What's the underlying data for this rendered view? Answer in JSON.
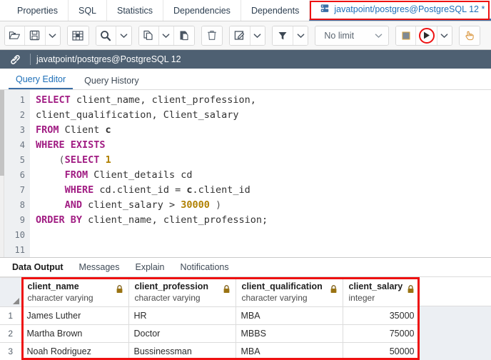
{
  "object_tabs": {
    "items": [
      {
        "label": "Properties",
        "active": false,
        "icon": ""
      },
      {
        "label": "SQL",
        "active": false,
        "icon": ""
      },
      {
        "label": "Statistics",
        "active": false,
        "icon": ""
      },
      {
        "label": "Dependencies",
        "active": false,
        "icon": ""
      },
      {
        "label": "Dependents",
        "active": false,
        "icon": ""
      },
      {
        "label": "javatpoint/postgres@PostgreSQL 12 *",
        "active": true,
        "icon": "database-server-icon"
      }
    ]
  },
  "toolbar": {
    "groups": [
      {
        "buttons": [
          {
            "name": "open-file-button",
            "icon": "open-folder-icon",
            "label": "Open File"
          },
          {
            "name": "save-file-button",
            "icon": "floppy-save-icon",
            "label": "Save"
          },
          {
            "name": "save-dropdown",
            "icon": "chevron-down-icon",
            "label": "Save options"
          }
        ]
      },
      {
        "buttons": [
          {
            "name": "edit-grid-button",
            "icon": "grid-edit-icon",
            "label": "Edit grid"
          }
        ]
      },
      {
        "buttons": [
          {
            "name": "find-button",
            "icon": "magnifier-icon",
            "label": "Find"
          },
          {
            "name": "find-dropdown",
            "icon": "chevron-down-icon",
            "label": "Find options"
          }
        ]
      },
      {
        "buttons": [
          {
            "name": "copy-button",
            "icon": "copy-icon",
            "label": "Copy"
          },
          {
            "name": "copy-dropdown",
            "icon": "chevron-down-icon",
            "label": "Copy options"
          },
          {
            "name": "paste-button",
            "icon": "paste-icon",
            "label": "Paste"
          }
        ]
      },
      {
        "buttons": [
          {
            "name": "delete-button",
            "icon": "trash-icon",
            "label": "Delete"
          }
        ]
      },
      {
        "buttons": [
          {
            "name": "edit-button",
            "icon": "pencil-square-icon",
            "label": "Edit"
          },
          {
            "name": "edit-dropdown",
            "icon": "chevron-down-icon",
            "label": "Edit options"
          }
        ]
      },
      {
        "buttons": [
          {
            "name": "filter-button",
            "icon": "funnel-filter-icon",
            "label": "Filter"
          },
          {
            "name": "filter-dropdown",
            "icon": "chevron-down-icon",
            "label": "Filter options"
          }
        ]
      }
    ],
    "row_limit": {
      "value": "No limit",
      "icon": "chevron-down-icon"
    },
    "exec_group": [
      {
        "name": "stop-button",
        "icon": "stop-square-icon",
        "label": "Stop"
      },
      {
        "name": "execute-button",
        "icon": "play-triangle-icon",
        "label": "Execute/Refresh",
        "annotated": true
      },
      {
        "name": "execute-dropdown",
        "icon": "chevron-down-icon",
        "label": "Execute options"
      }
    ],
    "macro_group": [
      {
        "name": "macros-button",
        "icon": "hand-pointer-icon",
        "label": "Macros"
      }
    ]
  },
  "connection_bar": {
    "icon": "link-connection-icon",
    "title": "javatpoint/postgres@PostgreSQL 12"
  },
  "editor_tabs": {
    "items": [
      {
        "label": "Query Editor",
        "active": true
      },
      {
        "label": "Query History",
        "active": false
      }
    ]
  },
  "sql_editor": {
    "line_numbers": [
      "1",
      "2",
      "3",
      "4",
      "5",
      "6",
      "7",
      "8",
      "9",
      "10",
      "11"
    ],
    "lines": [
      [
        {
          "t": "SELECT",
          "c": "kw"
        },
        {
          "t": " client_name, client_profession,",
          "c": "id"
        }
      ],
      [
        {
          "t": "client_qualification, Client_salary",
          "c": "id"
        }
      ],
      [
        {
          "t": "FROM",
          "c": "kw"
        },
        {
          "t": " Client ",
          "c": "id"
        },
        {
          "t": "c",
          "c": "al"
        }
      ],
      [
        {
          "t": "WHERE EXISTS",
          "c": "kw"
        }
      ],
      [
        {
          "t": "    (",
          "c": "pn"
        },
        {
          "t": "SELECT",
          "c": "kw"
        },
        {
          "t": " ",
          "c": "id"
        },
        {
          "t": "1",
          "c": "num"
        }
      ],
      [
        {
          "t": "     ",
          "c": "id"
        },
        {
          "t": "FROM",
          "c": "kw"
        },
        {
          "t": " Client_details cd",
          "c": "id"
        }
      ],
      [
        {
          "t": "     ",
          "c": "id"
        },
        {
          "t": "WHERE",
          "c": "kw"
        },
        {
          "t": " cd.client_id = ",
          "c": "id"
        },
        {
          "t": "c",
          "c": "al"
        },
        {
          "t": ".client_id",
          "c": "id"
        }
      ],
      [
        {
          "t": "     ",
          "c": "id"
        },
        {
          "t": "AND",
          "c": "kw"
        },
        {
          "t": " client_salary > ",
          "c": "id"
        },
        {
          "t": "30000",
          "c": "num"
        },
        {
          "t": " )",
          "c": "pn"
        }
      ],
      [
        {
          "t": "ORDER BY",
          "c": "kw"
        },
        {
          "t": " client_name, client_profession;",
          "c": "id"
        }
      ],
      [],
      []
    ]
  },
  "bottom_tabs": {
    "items": [
      {
        "label": "Data Output",
        "active": true
      },
      {
        "label": "Messages",
        "active": false
      },
      {
        "label": "Explain",
        "active": false
      },
      {
        "label": "Notifications",
        "active": false
      }
    ]
  },
  "result_grid": {
    "columns": [
      {
        "name": "client_name",
        "type": "character varying",
        "lock_icon": "lock-icon",
        "align": "left"
      },
      {
        "name": "client_profession",
        "type": "character varying",
        "lock_icon": "lock-icon",
        "align": "left"
      },
      {
        "name": "client_qualification",
        "type": "character varying",
        "lock_icon": "lock-icon",
        "align": "left"
      },
      {
        "name": "client_salary",
        "type": "integer",
        "lock_icon": "lock-icon",
        "align": "right"
      }
    ],
    "rows": [
      {
        "n": "1",
        "cells": [
          "James Luther",
          "HR",
          "MBA",
          "35000"
        ]
      },
      {
        "n": "2",
        "cells": [
          "Martha Brown",
          "Doctor",
          "MBBS",
          "75000"
        ]
      },
      {
        "n": "3",
        "cells": [
          "Noah Rodriguez",
          "Bussinessman",
          "MBA",
          "50000"
        ]
      }
    ]
  },
  "annotations": {
    "accent_color": "#ee1111",
    "items": [
      {
        "name": "tab-highlight-box",
        "target": "active object tab"
      },
      {
        "name": "execute-button-circle",
        "target": "execute button"
      },
      {
        "name": "result-grid-box",
        "target": "result grid"
      }
    ]
  }
}
